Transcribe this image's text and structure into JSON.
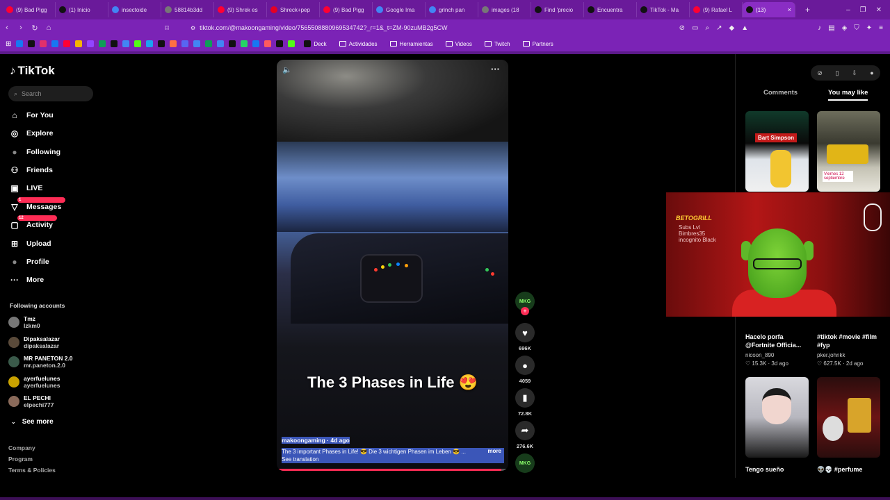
{
  "browser": {
    "tabs": [
      {
        "label": "(9) Bad Pigg",
        "fav": "yt",
        "color": "#ff0033"
      },
      {
        "label": "(1) Inicio",
        "fav": "x",
        "color": "#111111"
      },
      {
        "label": "insectoide",
        "fav": "g",
        "color": "#4285f4"
      },
      {
        "label": "58814b3dd",
        "fav": "g",
        "color": "#777777"
      },
      {
        "label": "(9) Shrek es",
        "fav": "yt",
        "color": "#ff0033"
      },
      {
        "label": "Shreck+pep",
        "fav": "p",
        "color": "#e60023"
      },
      {
        "label": "(9) Bad Pigg",
        "fav": "yt",
        "color": "#ff0033"
      },
      {
        "label": "Google Ima",
        "fav": "g",
        "color": "#4285f4"
      },
      {
        "label": "grinch pan",
        "fav": "g",
        "color": "#4285f4"
      },
      {
        "label": "images (18",
        "fav": "g",
        "color": "#777777"
      },
      {
        "label": "Find 'precio",
        "fav": "tt",
        "color": "#111111"
      },
      {
        "label": "Encuentra",
        "fav": "tt",
        "color": "#111111"
      },
      {
        "label": "TikTok - Ma",
        "fav": "tt",
        "color": "#111111"
      },
      {
        "label": "(9) Rafael L",
        "fav": "yt",
        "color": "#ff0033"
      },
      {
        "label": "(13)",
        "fav": "tt",
        "color": "#111111",
        "active": true
      }
    ],
    "new_tab": "+",
    "url": "tiktok.com/@makoongaming/video/7565508880969534742?_r=1&_t=ZM-90zuMB2g5CW",
    "bookmarks": [
      {
        "label": "Deck",
        "kind": "folder-less"
      },
      {
        "label": "Actividades",
        "kind": "folder"
      },
      {
        "label": "Herramientas",
        "kind": "folder"
      },
      {
        "label": "Videos",
        "kind": "folder"
      },
      {
        "label": "Twitch",
        "kind": "folder"
      },
      {
        "label": "Partners",
        "kind": "folder"
      }
    ]
  },
  "sidebar": {
    "logo": "TikTok",
    "search_placeholder": "Search",
    "nav": [
      {
        "label": "For You",
        "icon": "home-icon",
        "glyph": "⌂"
      },
      {
        "label": "Explore",
        "icon": "compass-icon",
        "glyph": "◎"
      },
      {
        "label": "Following",
        "icon": "following-avatar-icon",
        "glyph": "●"
      },
      {
        "label": "Friends",
        "icon": "friends-icon",
        "glyph": "⚇"
      },
      {
        "label": "LIVE",
        "icon": "live-icon",
        "glyph": "▣"
      },
      {
        "label": "Messages",
        "icon": "messages-icon",
        "glyph": "▽",
        "badge": "1"
      },
      {
        "label": "Activity",
        "icon": "activity-icon",
        "glyph": "▢",
        "badge": "12"
      },
      {
        "label": "Upload",
        "icon": "upload-icon",
        "glyph": "⊞"
      },
      {
        "label": "Profile",
        "icon": "profile-avatar-icon",
        "glyph": "●"
      },
      {
        "label": "More",
        "icon": "more-icon",
        "glyph": "···"
      }
    ],
    "following_header": "Following accounts",
    "following": [
      {
        "name": "Tmz",
        "handle": "lzkm0"
      },
      {
        "name": "Dipaksalazar",
        "handle": "dipaksalazar"
      },
      {
        "name": "MR PANETON 2.0",
        "handle": "mr.paneton.2.0"
      },
      {
        "name": "ayerfuelunes",
        "handle": "ayerfuelunes"
      },
      {
        "name": "EL PECHI",
        "handle": "elpechi777"
      }
    ],
    "see_more": "See more",
    "footer": [
      "Company",
      "Program",
      "Terms & Policies"
    ]
  },
  "video": {
    "caption": "The 3 Phases in Life 😍",
    "author_line": "makoongaming · 4d ago",
    "description": "The 3 important Phases in Life! 😎 Die 3 wichtigen Phasen im Leben 😎 ...",
    "more": "more",
    "see_translation": "See translation",
    "progress": 0.97
  },
  "actions": {
    "avatar_label": "MKG",
    "likes": "696K",
    "comments": "4059",
    "saves": "72.8K",
    "shares": "276.6K"
  },
  "right_panel": {
    "tabs": [
      "Comments",
      "You may like"
    ],
    "active_tab": "You may like",
    "cards": [
      {
        "overlay": "Bart Simpson",
        "title": "",
        "user": "",
        "likes": "",
        "age": ""
      },
      {
        "overlay": "Viernes 12 septiembre",
        "title": "",
        "user": "",
        "likes": "",
        "age": ""
      },
      {
        "title": "Hacelo porfa @Fortnite Officia...",
        "user": "nicoon_890",
        "likes": "15.3K",
        "age": "3d ago"
      },
      {
        "title": "#tiktok #movie #film #fyp",
        "user": "pker.johnkk",
        "likes": "627.5K",
        "age": "2d ago"
      },
      {
        "title": "Tengo sueño",
        "user": "",
        "likes": "",
        "age": ""
      },
      {
        "title": "👽💀 #perfume",
        "user": "",
        "likes": "",
        "age": ""
      }
    ]
  },
  "webcam": {
    "overlay_brand": "BETOGRILL",
    "overlay_text": "Subs Lvl Bimbres35 incognito Black"
  }
}
